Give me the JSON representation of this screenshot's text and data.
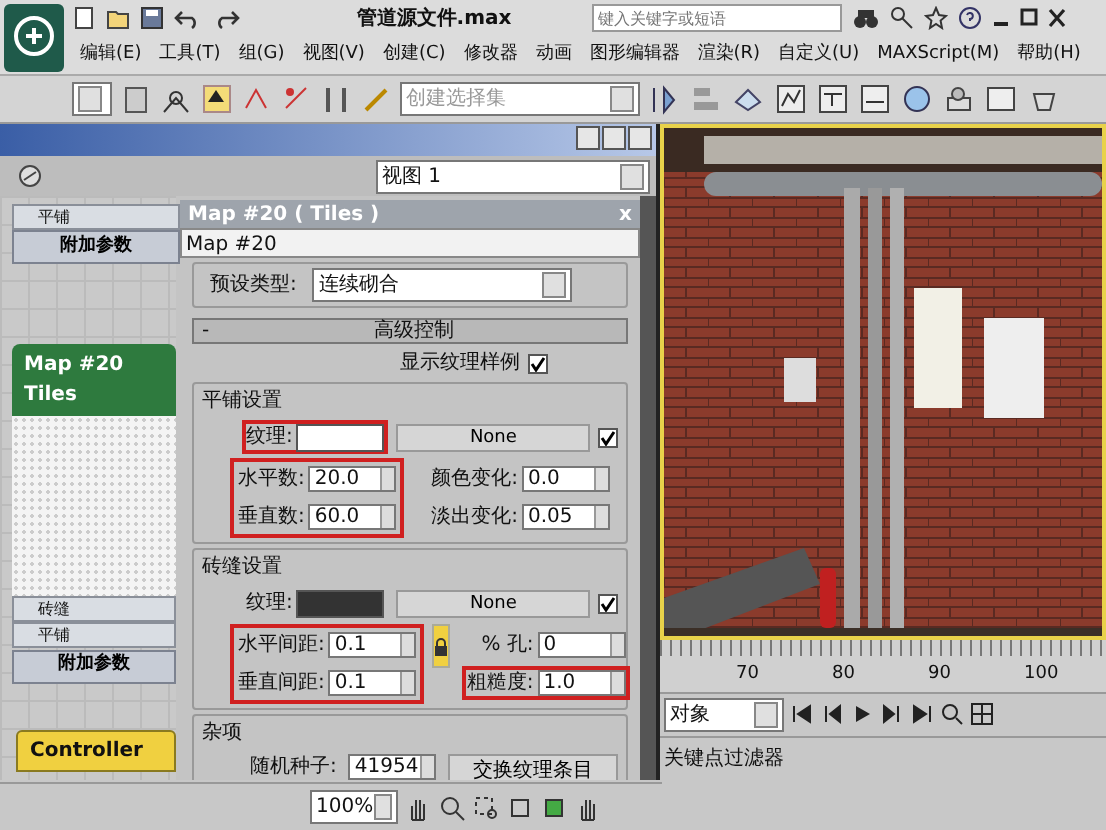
{
  "app": {
    "title": "管道源文件.max",
    "search_placeholder": "键入关键字或短语"
  },
  "menu": [
    {
      "label": "编辑(E)"
    },
    {
      "label": "工具(T)"
    },
    {
      "label": "组(G)"
    },
    {
      "label": "视图(V)"
    },
    {
      "label": "创建(C)"
    },
    {
      "label": "修改器"
    },
    {
      "label": "动画"
    },
    {
      "label": "图形编辑器"
    },
    {
      "label": "渲染(R)"
    },
    {
      "label": "自定义(U)"
    },
    {
      "label": "MAXScript(M)"
    },
    {
      "label": "帮助(H)"
    }
  ],
  "toolbar": {
    "selection_set_placeholder": "创建选择集"
  },
  "material_editor": {
    "view_select": "视图 1",
    "upper_node": {
      "params": [
        "平铺"
      ],
      "button": "附加参数"
    },
    "map_node": {
      "title": "Map #20",
      "subtitle": "Tiles",
      "params": [
        "砖缝",
        "平铺"
      ],
      "button": "附加参数"
    },
    "controller_node": {
      "label": "Controller"
    },
    "map_panel": {
      "title": "Map #20 ( Tiles )",
      "close": "x",
      "name": "Map #20",
      "preset_label": "预设类型:",
      "preset_value": "连续砌合",
      "rollout": {
        "sign": "-",
        "title": "高级控制"
      },
      "show_sample": {
        "label": "显示纹理样例",
        "checked": true
      },
      "groups": [
        {
          "kind": "tiles",
          "title": "平铺设置",
          "texture": {
            "label": "纹理:",
            "color": "#ffffff",
            "map": "None",
            "checked": true,
            "highlighted": true
          },
          "lock": false,
          "columns": [
            {
              "highlighted": true,
              "fields": [
                {
                  "label": "水平数:",
                  "value": "20.0",
                  "highlighted": false
                },
                {
                  "label": "垂直数:",
                  "value": "60.0",
                  "highlighted": false
                }
              ]
            },
            {
              "highlighted": false,
              "fields": [
                {
                  "label": "颜色变化:",
                  "value": "0.0",
                  "highlighted": false
                },
                {
                  "label": "淡出变化:",
                  "value": "0.05",
                  "highlighted": false
                }
              ]
            }
          ]
        },
        {
          "kind": "tiles",
          "title": "砖缝设置",
          "texture": {
            "label": "纹理:",
            "color": "#333333",
            "map": "None",
            "checked": true,
            "highlighted": false
          },
          "lock": true,
          "columns": [
            {
              "highlighted": true,
              "fields": [
                {
                  "label": "水平间距:",
                  "value": "0.1",
                  "highlighted": false
                },
                {
                  "label": "垂直间距:",
                  "value": "0.1",
                  "highlighted": false
                }
              ]
            },
            {
              "highlighted": false,
              "fields": [
                {
                  "label": "% 孔:",
                  "value": "0",
                  "highlighted": false
                },
                {
                  "label": "粗糙度:",
                  "value": "1.0",
                  "highlighted": true
                }
              ]
            }
          ]
        },
        {
          "kind": "misc",
          "title": "杂项",
          "seed_label": "随机种子:",
          "seed_value": "41954",
          "button": "交换纹理条目"
        }
      ]
    }
  },
  "zoom_select": "100%",
  "timeline": {
    "ticks": [
      "70",
      "80",
      "90",
      "100"
    ],
    "filter_select": "对象",
    "key_filter": "关键点过滤器"
  }
}
